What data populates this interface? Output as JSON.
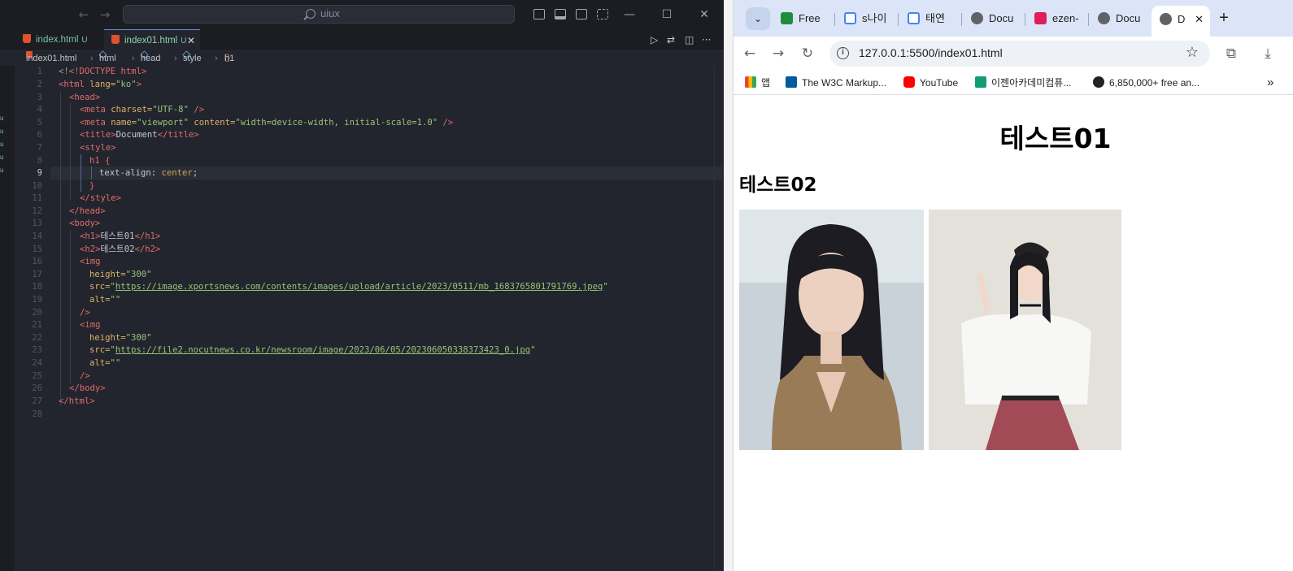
{
  "vscode": {
    "search_text": "uiux",
    "tabs": [
      {
        "label": "index.html",
        "status": "U"
      },
      {
        "label": "index01.html",
        "status": "U",
        "active": true
      }
    ],
    "breadcrumb": [
      "index01.html",
      "html",
      "head",
      "style",
      "h1"
    ],
    "current_line": 9,
    "line_numbers": [
      "1",
      "2",
      "3",
      "4",
      "5",
      "6",
      "7",
      "8",
      "9",
      "10",
      "11",
      "12",
      "13",
      "14",
      "15",
      "16",
      "17",
      "18",
      "19",
      "20",
      "21",
      "22",
      "23",
      "24",
      "25",
      "26",
      "27",
      "28"
    ],
    "code": {
      "l1": "<!DOCTYPE html>",
      "l2_open": "<html",
      "l2_attr": " lang=",
      "l2_val": "\"ko\"",
      "l2_close": ">",
      "l3": "<head>",
      "l4_tag": "<meta",
      "l4_attr": " charset=",
      "l4_val": "\"UTF-8\"",
      "l4_end": " />",
      "l5_tag": "<meta",
      "l5_attr1": " name=",
      "l5_val1": "\"viewport\"",
      "l5_attr2": " content=",
      "l5_val2": "\"width=device-width, initial-scale=1.0\"",
      "l5_end": " />",
      "l6_open": "<title>",
      "l6_text": "Document",
      "l6_close": "</title>",
      "l7": "<style>",
      "l8": "h1 {",
      "l9_prop": "text-align",
      "l9_colon": ": ",
      "l9_val": "center",
      "l9_semi": ";",
      "l10": "}",
      "l11": "</style>",
      "l12": "</head>",
      "l13": "<body>",
      "l14_open": "<h1>",
      "l14_text": "테스트01",
      "l14_close": "</h1>",
      "l15_open": "<h2>",
      "l15_text": "테스트02",
      "l15_close": "</h2>",
      "l16": "<img",
      "l17_attr": "height=",
      "l17_val": "\"300\"",
      "l18_attr": "src=",
      "l18_q1": "\"",
      "l18_url": "https://image.xportsnews.com/contents/images/upload/article/2023/0511/mb_1683765801791769.jpeg",
      "l18_q2": "\"",
      "l19_attr": "alt=",
      "l19_val": "\"\"",
      "l20": "/>",
      "l21": "<img",
      "l22_attr": "height=",
      "l22_val": "\"300\"",
      "l23_attr": "src=",
      "l23_q1": "\"",
      "l23_url": "https://file2.nocutnews.co.kr/newsroom/image/2023/06/05/202306050338373423_0.jpg",
      "l23_q2": "\"",
      "l24_attr": "alt=",
      "l24_val": "\"\"",
      "l25": "/>",
      "l26": "</body>",
      "l27": "</html>"
    }
  },
  "chrome": {
    "tabs": [
      "Free",
      "s나이",
      "태연",
      "Docu",
      "ezen-",
      "Docu",
      "D"
    ],
    "new_tab": "+",
    "address": "127.0.0.1:5500/index01.html",
    "bookmarks": [
      "앱",
      "The W3C Markup...",
      "YouTube",
      "이젠아카데미컴퓨...",
      "6,850,000+ free an..."
    ],
    "page": {
      "h1": "테스트01",
      "h2": "테스트02"
    }
  },
  "colors": {
    "editor_bg": "#22252d",
    "tag": "#e06c6c",
    "attr": "#dcb368",
    "string": "#98c379",
    "chrome_tabstrip": "#dbe5f7"
  }
}
